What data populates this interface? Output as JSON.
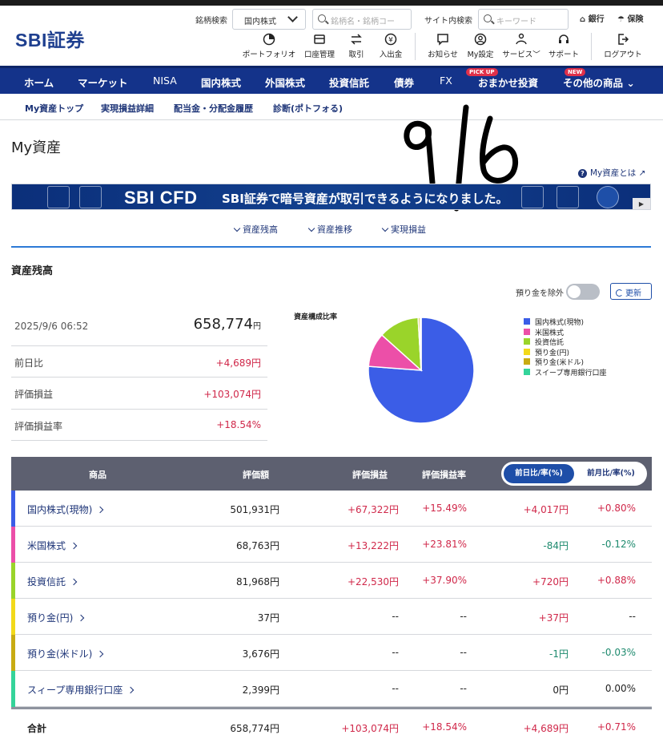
{
  "header": {
    "logo": "SBI証券",
    "brand_search_label": "銘柄検索",
    "market_select": "国内株式",
    "brand_search_placeholder": "銘柄名・銘柄コー",
    "site_search_label": "サイト内検索",
    "site_search_placeholder": "キーワード",
    "bank_link": "銀行",
    "insurance_link": "保険",
    "tools": [
      {
        "label": "ポートフォリオ",
        "icon": "portfolio-icon"
      },
      {
        "label": "口座管理",
        "icon": "account-icon"
      },
      {
        "label": "取引",
        "icon": "trade-icon"
      },
      {
        "label": "入出金",
        "icon": "deposit-icon"
      },
      {
        "label": "お知らせ",
        "icon": "notice-icon"
      },
      {
        "label": "My設定",
        "icon": "user-icon"
      },
      {
        "label": "サービス",
        "icon": "service-icon"
      },
      {
        "label": "サポート",
        "icon": "support-icon"
      },
      {
        "label": "ログアウト",
        "icon": "logout-icon"
      }
    ]
  },
  "nav": {
    "items": [
      "ホーム",
      "マーケット",
      "NISA",
      "国内株式",
      "外国株式",
      "投資信託",
      "債券",
      "FX",
      "おまかせ投資",
      "その他の商品"
    ],
    "pickup_badge": "PICK UP",
    "new_badge": "NEW"
  },
  "subnav": {
    "items": [
      "My資産トップ",
      "実現損益詳細",
      "配当金・分配金履歴",
      "診断(ポトフォる)"
    ]
  },
  "page": {
    "title": "My資産",
    "handwritten_note": "9/6",
    "help_link": "My資産とは"
  },
  "banner": {
    "title": "SBI CFD",
    "text": "SBI証券で暗号資産が取引できるようになりました。"
  },
  "anchors": [
    "資産残高",
    "資産推移",
    "実現損益"
  ],
  "balance": {
    "section_title": "資産残高",
    "exclude_deposit_label": "預り金を除外",
    "refresh_label": "更新",
    "datetime": "2025/9/6 06:52",
    "total": "658,774",
    "yen": "円",
    "rows": [
      {
        "label": "前日比",
        "value": "+4,689円"
      },
      {
        "label": "評価損益",
        "value": "+103,074円"
      },
      {
        "label": "評価損益率",
        "value": "+18.54%"
      }
    ]
  },
  "chart_data": {
    "type": "pie",
    "title": "資産構成比率",
    "labels": [
      "国内株式(現物)",
      "米国株式",
      "投資信託",
      "預り金(円)",
      "預り金(米ドル)",
      "スイープ専用銀行口座"
    ],
    "values": [
      501931,
      68763,
      81968,
      37,
      3676,
      2399
    ],
    "colors": [
      "#3b5de7",
      "#ec4fa8",
      "#9ad42a",
      "#f2d91a",
      "#c8ab12",
      "#34d49a"
    ]
  },
  "table": {
    "headers": {
      "product": "商品",
      "valuation": "評価額",
      "pl": "評価損益",
      "pl_rate": "評価損益率"
    },
    "toggle_on": "前日比/率(%)",
    "toggle_off": "前月比/率(%)",
    "rows": [
      {
        "name": "国内株式(現物)",
        "valuation": "501,931円",
        "pl": "+67,322円",
        "pl_rate": "+15.49%",
        "day": "+4,017円",
        "day_rate": "+0.80%",
        "pl_cls": "pos",
        "day_cls": "pos",
        "rate_cls": "pos"
      },
      {
        "name": "米国株式",
        "valuation": "68,763円",
        "pl": "+13,222円",
        "pl_rate": "+23.81%",
        "day": "-84円",
        "day_rate": "-0.12%",
        "pl_cls": "pos",
        "day_cls": "neg",
        "rate_cls": "neg"
      },
      {
        "name": "投資信託",
        "valuation": "81,968円",
        "pl": "+22,530円",
        "pl_rate": "+37.90%",
        "day": "+720円",
        "day_rate": "+0.88%",
        "pl_cls": "pos",
        "day_cls": "pos",
        "rate_cls": "pos"
      },
      {
        "name": "預り金(円)",
        "valuation": "37円",
        "pl": "--",
        "pl_rate": "--",
        "day": "+37円",
        "day_rate": "--",
        "pl_cls": "neu",
        "day_cls": "pos",
        "rate_cls": "neu"
      },
      {
        "name": "預り金(米ドル)",
        "valuation": "3,676円",
        "pl": "--",
        "pl_rate": "--",
        "day": "-1円",
        "day_rate": "-0.03%",
        "pl_cls": "neu",
        "day_cls": "neg",
        "rate_cls": "neg"
      },
      {
        "name": "スィープ専用銀行口座",
        "valuation": "2,399円",
        "pl": "--",
        "pl_rate": "--",
        "day": "0円",
        "day_rate": "0.00%",
        "pl_cls": "neu",
        "day_cls": "neu",
        "rate_cls": "neu"
      }
    ],
    "total": {
      "label": "合計",
      "valuation": "658,774円",
      "pl": "+103,074円",
      "pl_rate": "+18.54%",
      "day": "+4,689円",
      "day_rate": "+0.71%"
    }
  }
}
